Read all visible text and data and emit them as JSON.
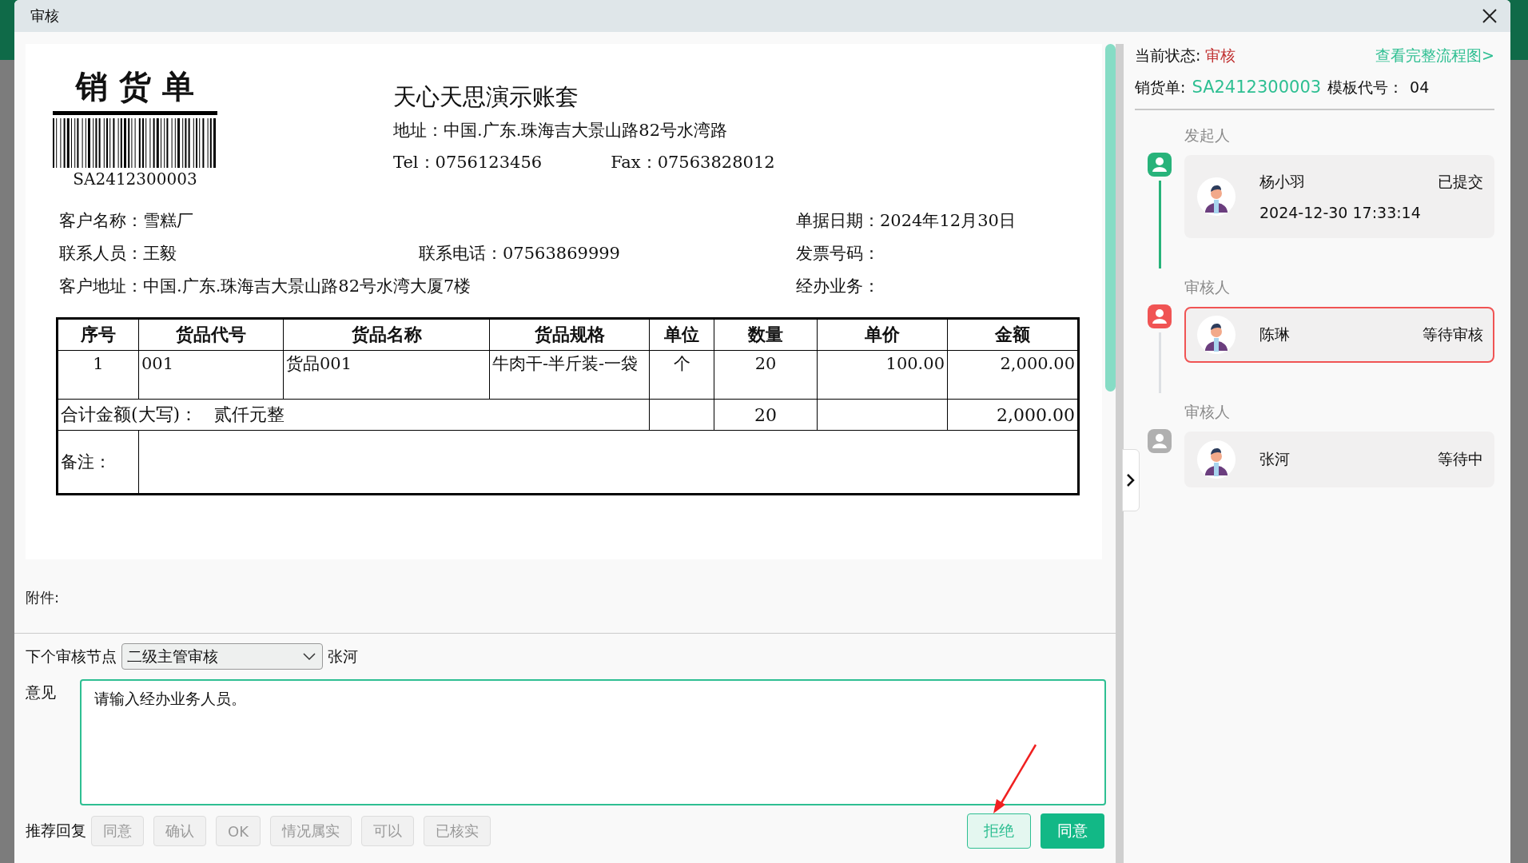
{
  "window": {
    "title": "审核"
  },
  "document": {
    "title": "销 货 单",
    "barcode_text": "SA2412300003",
    "company": "天心天思演示账套",
    "address": "地址：中国.广东.珠海吉大景山路82号水湾路",
    "tel": "Tel：0756123456",
    "fax": "Fax：07563828012",
    "info_rows": [
      {
        "left": "客户名称：雪糕厂",
        "right": "单据日期：2024年12月30日"
      },
      {
        "left": "联系人员：王毅",
        "middle": "联系电话：07563869999",
        "right": "发票号码："
      },
      {
        "left": "客户地址：中国.广东.珠海吉大景山路82号水湾大厦7楼",
        "right": "经办业务："
      }
    ],
    "table": {
      "columns": [
        "序号",
        "货品代号",
        "货品名称",
        "货品规格",
        "单位",
        "数量",
        "单价",
        "金额"
      ],
      "rows": [
        [
          "1",
          "001",
          "货品001",
          "牛肉干-半斤装-一袋",
          "个",
          "20",
          "100.00",
          "2,000.00"
        ]
      ],
      "total": {
        "label": "合计金额(大写)：",
        "amount_words": "贰仟元整",
        "quantity": "20",
        "amount": "2,000.00"
      },
      "remark_label": "备注："
    }
  },
  "attachments_label": "附件:",
  "review": {
    "next_node_label": "下个审核节点",
    "next_node": "二级主管审核",
    "next_reviewer": "张河",
    "opinion_label": "意见",
    "opinion": "请输入经办业务人员。",
    "suggest_label": "推荐回复",
    "suggestions": [
      "同意",
      "确认",
      "OK",
      "情况属实",
      "可以",
      "已核实"
    ],
    "reject": "拒绝",
    "approve": "同意"
  },
  "status_panel": {
    "status_label": "当前状态:",
    "status": "审核",
    "flow_link": "查看完整流程图>",
    "doc_label": "销货单:",
    "doc_no": "SA2412300003",
    "template_label": "模板代号：",
    "template": "04",
    "steps": [
      {
        "role": "发起人",
        "name": "杨小羽",
        "status": "已提交",
        "time": "2024-12-30 17:33:14",
        "kind": "done"
      },
      {
        "role": "审核人",
        "name": "陈琳",
        "status": "等待审核",
        "kind": "current"
      },
      {
        "role": "审核人",
        "name": "张河",
        "status": "等待中",
        "kind": "pending"
      }
    ]
  }
}
